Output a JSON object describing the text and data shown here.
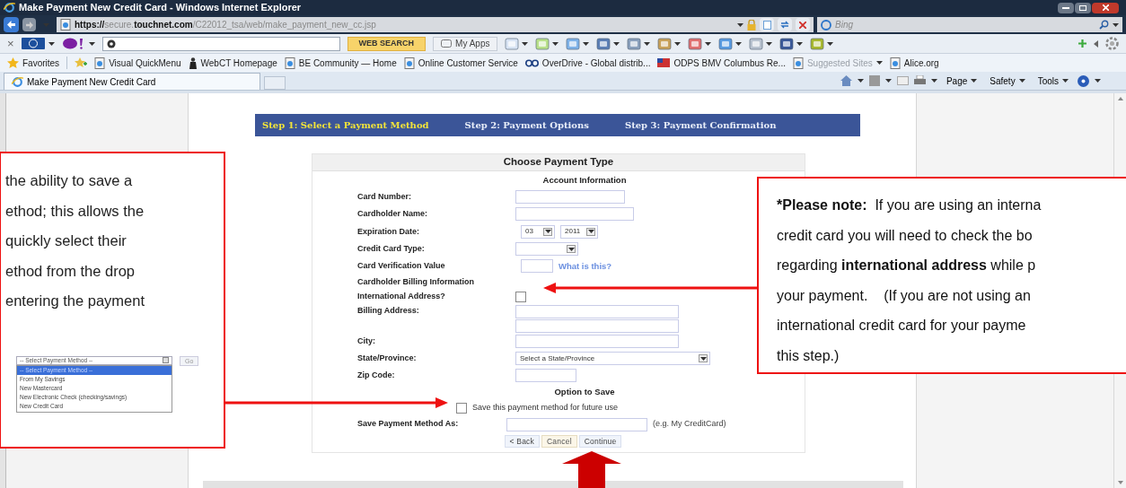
{
  "window": {
    "title": "Make Payment New Credit Card - Windows Internet Explorer"
  },
  "address_bar": {
    "url_parts": [
      {
        "text": "https://",
        "dim": false
      },
      {
        "text": "secure.",
        "dim": true
      },
      {
        "text": "touchnet.com",
        "dim": false
      },
      {
        "text": "/C22012_tsa/web/make_payment_new_cc.jsp",
        "dim": true
      }
    ],
    "search_placeholder": "Bing"
  },
  "toolbar": {
    "close": "×",
    "search_button": "WEB SEARCH",
    "apps": "My Apps"
  },
  "favorites": [
    {
      "label": "Favorites",
      "kind": "star"
    },
    {
      "label": "Visual QuickMenu",
      "kind": "page"
    },
    {
      "label": "WebCT Homepage",
      "kind": "figure"
    },
    {
      "label": "BE Community — Home",
      "kind": "page"
    },
    {
      "label": "Online Customer Service",
      "kind": "page"
    },
    {
      "label": "OverDrive - Global distrib...",
      "kind": "od"
    },
    {
      "label": "ODPS BMV Columbus Re...",
      "kind": "flag"
    },
    {
      "label": "Suggested Sites",
      "kind": "dim"
    },
    {
      "label": "Alice.org",
      "kind": "page"
    }
  ],
  "tabs": [
    {
      "label": "Make Payment New Credit Card",
      "selected": true
    }
  ],
  "command_bar": [
    "Page",
    "Safety",
    "Tools"
  ],
  "steps": [
    {
      "label": "Step 1: Select a Payment Method",
      "selected": true
    },
    {
      "label": "Step 2: Payment Options",
      "selected": false
    },
    {
      "label": "Step 3: Payment Confirmation",
      "selected": false
    }
  ],
  "form": {
    "title": "Choose Payment Type",
    "rows": [
      {
        "kind": "heading",
        "label": "Account Information"
      },
      {
        "kind": "text",
        "label": "Card Number:"
      },
      {
        "kind": "text",
        "label": "Cardholder Name:"
      },
      {
        "kind": "date",
        "label": "Expiration Date:",
        "month": "03",
        "year": "2011"
      },
      {
        "kind": "select",
        "label": "Credit Card Type:",
        "value": ""
      },
      {
        "kind": "cvv",
        "label": "Card Verification Value",
        "link": "What is this?"
      },
      {
        "kind": "subheading",
        "label": "Cardholder Billing Information"
      },
      {
        "kind": "checkbox",
        "label": "International Address?",
        "checked": false
      },
      {
        "kind": "text2",
        "label": "Billing Address:"
      },
      {
        "kind": "text",
        "label": "City:"
      },
      {
        "kind": "select",
        "label": "State/Province:",
        "value": "Select a State/Province"
      },
      {
        "kind": "text",
        "label": "Zip Code:"
      },
      {
        "kind": "heading",
        "label": "Option to Save"
      },
      {
        "kind": "option",
        "label": "Save this payment method for future use",
        "checked": false
      },
      {
        "kind": "saveas",
        "label": "Save Payment Method As:",
        "hint": "(e.g. My CreditCard)"
      }
    ],
    "buttons": [
      {
        "label": "< Back",
        "kind": "plain"
      },
      {
        "label": "Cancel",
        "kind": "cancel"
      },
      {
        "label": "Continue",
        "kind": "plain"
      }
    ]
  },
  "callouts": [
    {
      "lines": [
        [
          {
            "text": "the ability to save a",
            "bold": false
          }
        ],
        [
          {
            "text": "ethod; this allows the",
            "bold": false
          }
        ],
        [
          {
            "text": "quickly select their",
            "bold": false
          }
        ],
        [
          {
            "text": "ethod from the drop",
            "bold": false
          }
        ],
        [
          {
            "text": "entering the payment",
            "bold": false
          }
        ]
      ],
      "inset": {
        "value": "-- Select Payment Method --",
        "button": "Go",
        "options": [
          {
            "label": "-- Select Payment Method --",
            "selected": true
          },
          {
            "label": "From My Savings",
            "selected": false
          },
          {
            "label": "New Mastercard",
            "selected": false
          },
          {
            "label": "New Electronic Check (checking/savings)",
            "selected": false
          },
          {
            "label": "New Credit Card",
            "selected": false
          }
        ]
      }
    },
    {
      "lines": [
        [
          {
            "text": "*Please note:",
            "bold": true
          },
          {
            "text": "  If you are using an interna",
            "bold": false
          }
        ],
        [
          {
            "text": "credit card you will need to check the bo",
            "bold": false
          }
        ],
        [
          {
            "text": "regarding ",
            "bold": false
          },
          {
            "text": "international address",
            "bold": true
          },
          {
            "text": " while p",
            "bold": false
          }
        ],
        [
          {
            "text": "your payment.    (If you are not using an",
            "bold": false
          }
        ],
        [
          {
            "text": "international credit card for your payme",
            "bold": false
          }
        ],
        [
          {
            "text": "this step.)",
            "bold": false
          }
        ]
      ]
    }
  ]
}
